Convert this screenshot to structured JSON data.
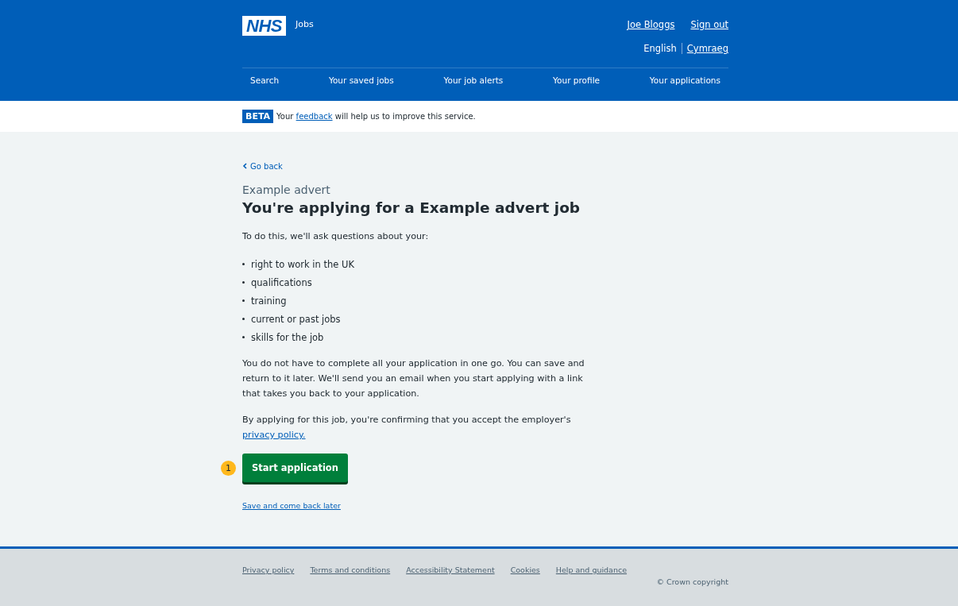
{
  "header": {
    "logo": "NHS",
    "service": "Jobs",
    "account_links": [
      "Joe Bloggs",
      "Sign out"
    ],
    "languages": [
      {
        "label": "English",
        "selected": true
      },
      {
        "label": "Cymraeg",
        "selected": false
      }
    ],
    "nav": [
      "Search",
      "Your saved jobs",
      "Your job alerts",
      "Your profile",
      "Your applications"
    ]
  },
  "beta_banner": {
    "tag": "BETA",
    "before": "Your",
    "link": "feedback",
    "after": "will help us to improve this service."
  },
  "main": {
    "back_link": "Go back",
    "caption": "Example advert",
    "title": "You're applying for a Example advert job",
    "intro": "To do this, we'll ask questions about your:",
    "list": [
      "right to work in the UK",
      "qualifications",
      "training",
      "current or past jobs",
      "skills for the job"
    ],
    "paragraph": "You do not have to complete all your application in one go. You can save and return to it later. We'll send you an email when you start applying with a link that takes you back to your application.",
    "consent": {
      "text": "By applying for this job, you're confirming that you accept the employer's",
      "link": "privacy policy."
    },
    "step_marker": "1",
    "primary_button": "Start application",
    "secondary_link": "Save and come back later"
  },
  "footer": {
    "links": [
      "Privacy policy",
      "Terms and conditions",
      "Accessibility Statement",
      "Cookies",
      "Help and guidance"
    ],
    "copyright": "© Crown copyright"
  }
}
